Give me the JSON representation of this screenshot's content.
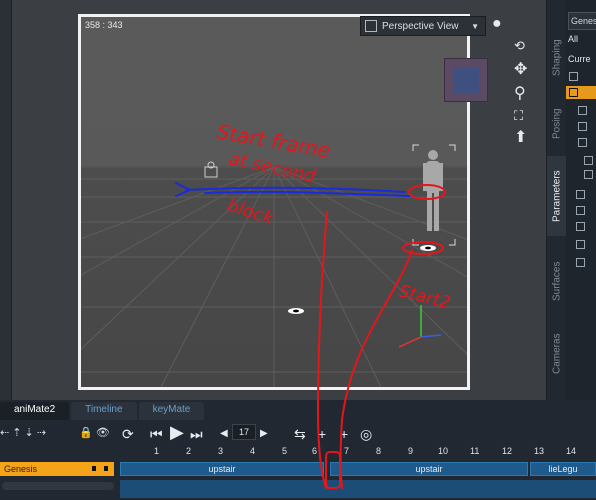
{
  "viewport": {
    "coords": "358 : 343",
    "camera_label": "Perspective View",
    "annotations": {
      "start_frame": "Start frame",
      "at_second": "at second",
      "block": "block",
      "start2": "Start2"
    }
  },
  "side_tabs": {
    "shaping": "Shaping",
    "posing": "Posing",
    "parameters": "Parameters",
    "surfaces": "Surfaces",
    "cameras": "Cameras"
  },
  "params": {
    "search_value": "Genesi",
    "tab_all": "All",
    "current": "Curre"
  },
  "animate": {
    "tabs": [
      "aniMate2",
      "Timeline",
      "keyMate"
    ],
    "frame_value": "17",
    "ruler_ticks": [
      "1",
      "2",
      "3",
      "4",
      "5",
      "6",
      "7",
      "8",
      "9",
      "10",
      "11",
      "12",
      "13",
      "14"
    ],
    "track_name": "Genesis",
    "blocks": [
      "upstair",
      "upstair",
      "lieLegu"
    ]
  },
  "colors": {
    "selection_orange": "#f5a319",
    "block_blue": "#1e5a8c",
    "annotation_red": "#e5161b",
    "annotation_blue": "#1a2bd9"
  }
}
